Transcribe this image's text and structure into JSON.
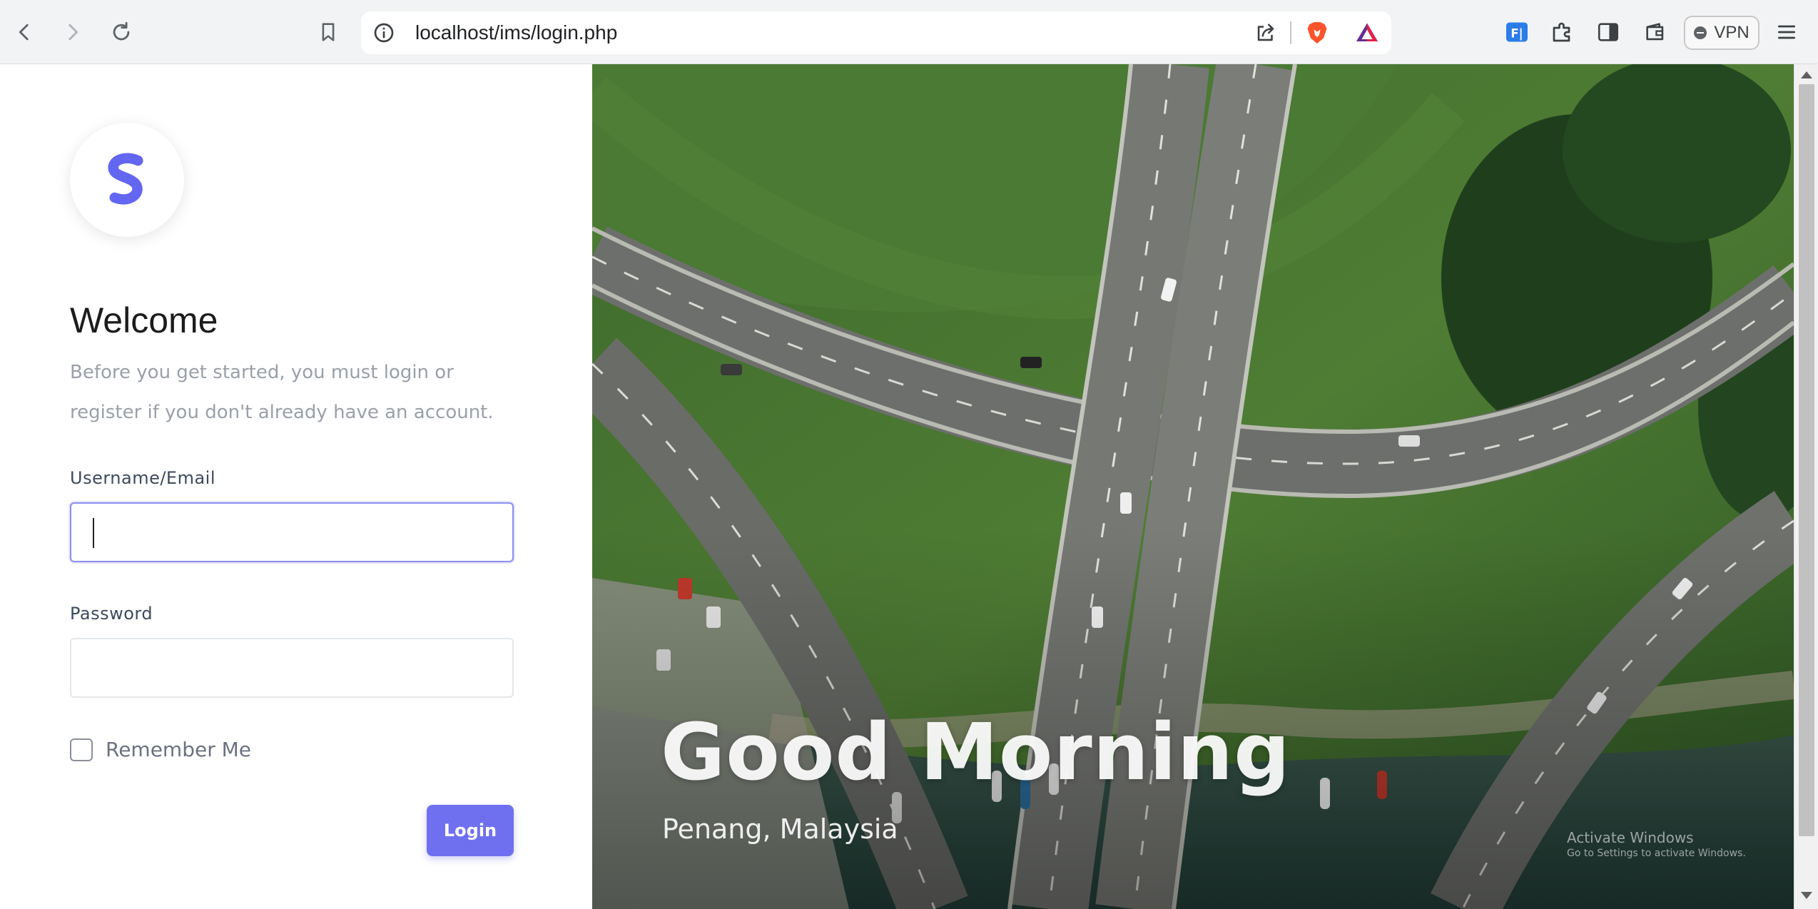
{
  "browser": {
    "url": "localhost/ims/login.php",
    "vpn_label": "VPN"
  },
  "login": {
    "welcome_title": "Welcome",
    "subtitle": "Before you get started, you must login or register if you don't already have an account.",
    "username_label": "Username/Email",
    "username_value": "",
    "password_label": "Password",
    "password_value": "",
    "remember_label": "Remember Me",
    "remember_checked": false,
    "login_button": "Login"
  },
  "hero": {
    "greeting": "Good Morning",
    "location": "Penang, Malaysia"
  },
  "watermark": {
    "line1": "Activate Windows",
    "line2": "Go to Settings to activate Windows."
  },
  "colors": {
    "accent": "#6f70ef",
    "logo": "#6366f1"
  }
}
